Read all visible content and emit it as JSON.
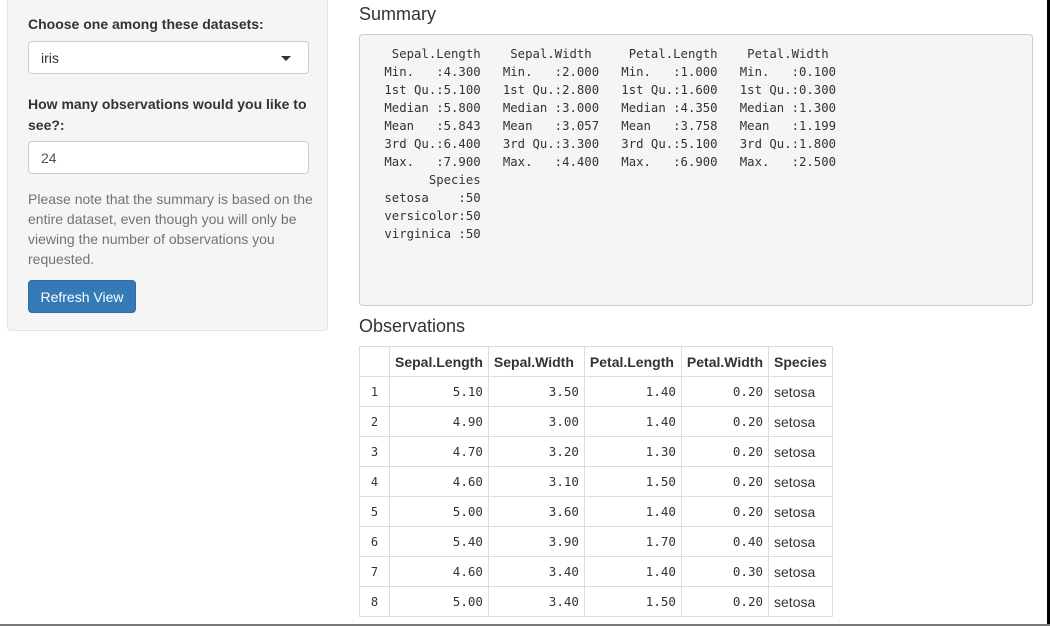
{
  "sidebar": {
    "dataset_label": "Choose one among these datasets:",
    "dataset_value": "iris",
    "obs_label": "How many observations would you like to see?:",
    "obs_value": "24",
    "note": "Please note that the summary is based on the entire dataset, even though you will only be viewing the number of observations you requested.",
    "refresh_label": "Refresh View"
  },
  "summary": {
    "heading": "Summary",
    "text": "  Sepal.Length    Sepal.Width     Petal.Length    Petal.Width   \n Min.   :4.300   Min.   :2.000   Min.   :1.000   Min.   :0.100  \n 1st Qu.:5.100   1st Qu.:2.800   1st Qu.:1.600   1st Qu.:0.300  \n Median :5.800   Median :3.000   Median :4.350   Median :1.300  \n Mean   :5.843   Mean   :3.057   Mean   :3.758   Mean   :1.199  \n 3rd Qu.:6.400   3rd Qu.:3.300   3rd Qu.:5.100   3rd Qu.:1.800  \n Max.   :7.900   Max.   :4.400   Max.   :6.900   Max.   :2.500  \n       Species  \n setosa    :50  \n versicolor:50  \n virginica :50  "
  },
  "observations": {
    "heading": "Observations",
    "columns": [
      "",
      "Sepal.Length",
      "Sepal.Width",
      "Petal.Length",
      "Petal.Width",
      "Species"
    ],
    "rows": [
      [
        "1",
        "5.10",
        "3.50",
        "1.40",
        "0.20",
        "setosa"
      ],
      [
        "2",
        "4.90",
        "3.00",
        "1.40",
        "0.20",
        "setosa"
      ],
      [
        "3",
        "4.70",
        "3.20",
        "1.30",
        "0.20",
        "setosa"
      ],
      [
        "4",
        "4.60",
        "3.10",
        "1.50",
        "0.20",
        "setosa"
      ],
      [
        "5",
        "5.00",
        "3.60",
        "1.40",
        "0.20",
        "setosa"
      ],
      [
        "6",
        "5.40",
        "3.90",
        "1.70",
        "0.40",
        "setosa"
      ],
      [
        "7",
        "4.60",
        "3.40",
        "1.40",
        "0.30",
        "setosa"
      ],
      [
        "8",
        "5.00",
        "3.40",
        "1.50",
        "0.20",
        "setosa"
      ]
    ]
  }
}
